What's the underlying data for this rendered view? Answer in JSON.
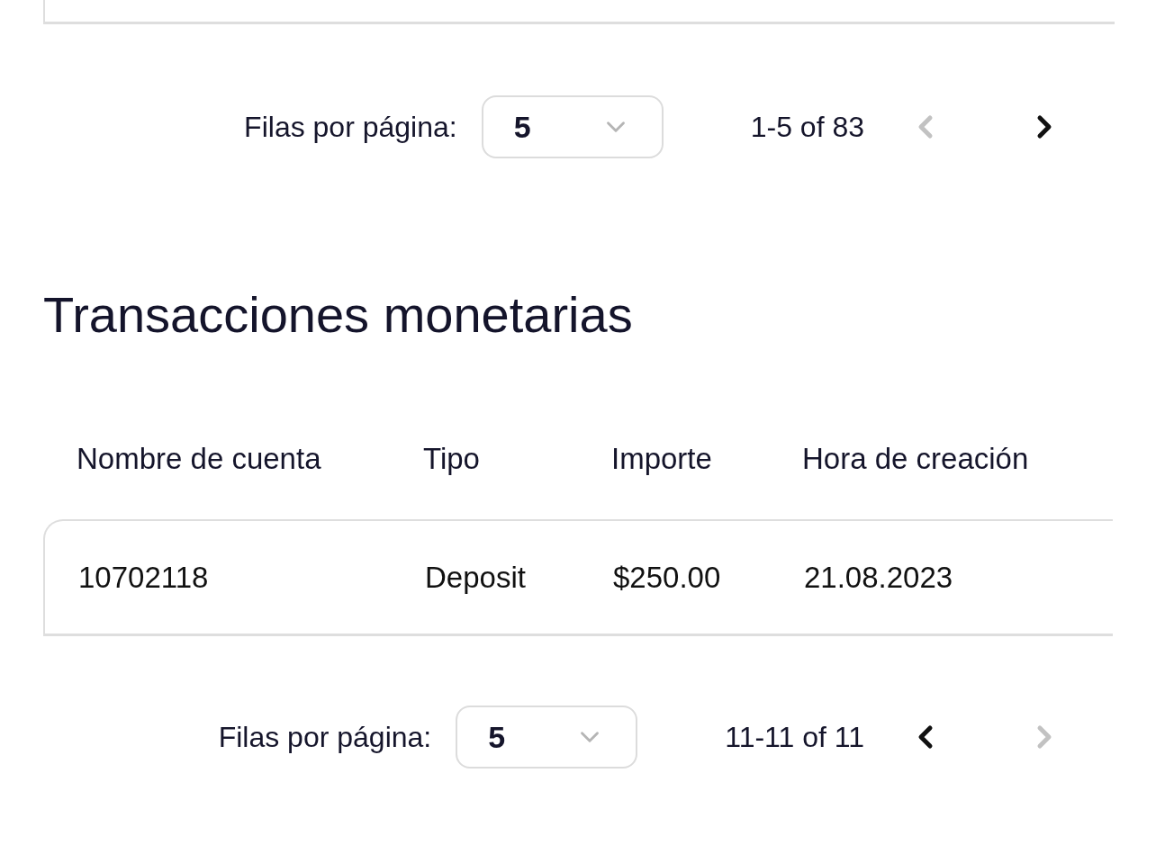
{
  "top_pager": {
    "label": "Filas por página:",
    "rows_per_page": "5",
    "range": "1-5 of 83",
    "prev_disabled": true,
    "next_disabled": false
  },
  "transactions": {
    "title": "Transacciones monetarias",
    "columns": [
      "Nombre de cuenta",
      "Tipo",
      "Importe",
      "Hora de creación"
    ],
    "rows": [
      [
        "10702118",
        "Deposit",
        "$250.00",
        "21.08.2023"
      ]
    ],
    "pager": {
      "label": "Filas por página:",
      "rows_per_page": "5",
      "range": "11-11 of 11",
      "prev_disabled": false,
      "next_disabled": true
    }
  }
}
